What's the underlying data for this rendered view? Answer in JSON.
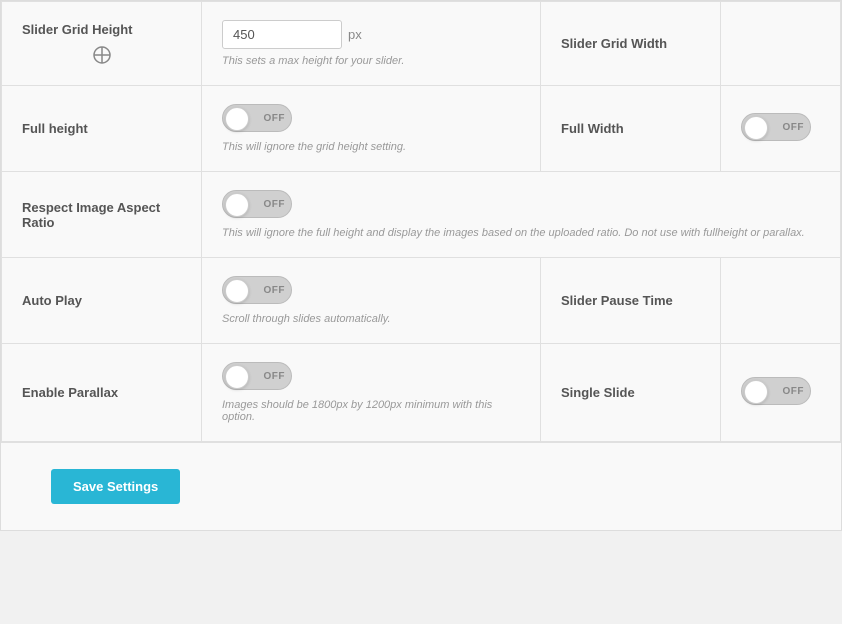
{
  "settings": {
    "sliderGridHeight": {
      "label": "Slider Grid Height",
      "value": "450",
      "unit": "px",
      "hint": "This sets a max height for your slider."
    },
    "sliderGridWidth": {
      "label": "Slider Grid Width"
    },
    "fullHeight": {
      "label": "Full height",
      "state": "OFF",
      "hint": "This will ignore the grid height setting."
    },
    "fullWidth": {
      "label": "Full Width",
      "state": "OFF"
    },
    "respectImageAspectRatio": {
      "label": "Respect Image Aspect Ratio",
      "state": "OFF",
      "hint": "This will ignore the full height and display the images based on the uploaded ratio. Do not use with fullheight or parallax."
    },
    "autoPlay": {
      "label": "Auto Play",
      "state": "OFF",
      "hint": "Scroll through slides automatically."
    },
    "sliderPauseTime": {
      "label": "Slider Pause Time"
    },
    "enableParallax": {
      "label": "Enable Parallax",
      "state": "OFF",
      "hint": "Images should be 1800px by 1200px minimum with this option."
    },
    "singleSlide": {
      "label": "Single Slide",
      "state": "OFF"
    }
  },
  "buttons": {
    "saveSettings": "Save Settings"
  }
}
